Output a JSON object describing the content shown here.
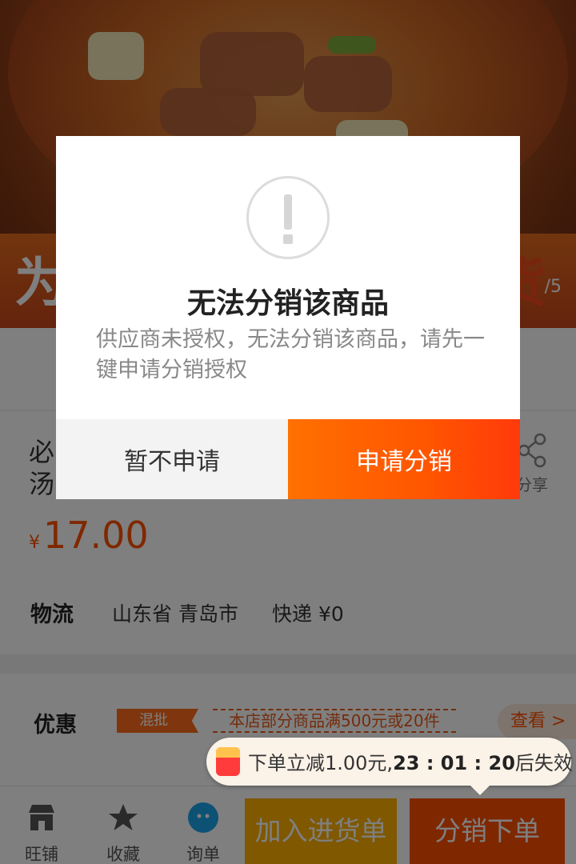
{
  "banner": {
    "left_char": "为",
    "right_char": "货",
    "pager": "/5"
  },
  "product": {
    "title_line1": "必",
    "title_line2": "汤",
    "share_label": "分享",
    "currency": "¥",
    "price": "17.00"
  },
  "logistics": {
    "label": "物流",
    "place": "山东省 青岛市",
    "shipping": "快递 ¥0"
  },
  "promo": {
    "label": "优惠",
    "tag": "混批",
    "text": "本店部分商品满500元或20件",
    "more": "查看 >"
  },
  "coupon": {
    "text_before": "下单立减1.00元,",
    "time": "23 : 01 : 20",
    "text_after": "后失效"
  },
  "bottom_bar": {
    "shop": "旺铺",
    "favorite": "收藏",
    "inquiry": "询单",
    "cart_button": "加入进货单",
    "order_button": "分销下单"
  },
  "dialog": {
    "title": "无法分销该商品",
    "message": "供应商未授权，无法分销该商品，请先一键申请分销授权",
    "cancel_button": "暂不申请",
    "apply_button": "申请分销"
  },
  "colors": {
    "accent": "#ff5000",
    "cart": "#ffb100",
    "overlay": "rgba(0,0,0,0.5)"
  }
}
